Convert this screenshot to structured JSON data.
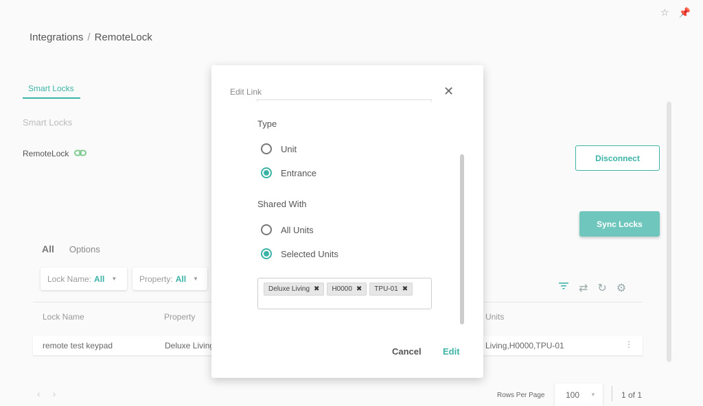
{
  "header": {
    "breadcrumb": [
      "Integrations",
      "RemoteLock"
    ],
    "breadcrumb_sep": "/",
    "icons": [
      "star-icon",
      "pin-icon"
    ]
  },
  "tabs": {
    "active": "Smart Locks"
  },
  "section": {
    "title": "Smart Locks"
  },
  "integration": {
    "name": "RemoteLock",
    "status_icon": "link-icon"
  },
  "buttons": {
    "disconnect": "Disconnect",
    "sync": "Sync Locks"
  },
  "subtabs": {
    "all": "All",
    "options": "Options"
  },
  "filters": [
    {
      "label": "Lock Name:",
      "value": "All"
    },
    {
      "label": "Property:",
      "value": "All"
    }
  ],
  "toolbar_icons": [
    "filter-icon",
    "sync-icon",
    "refresh-icon",
    "settings-icon"
  ],
  "table": {
    "columns": [
      "Lock Name",
      "Property",
      "Units"
    ],
    "rows": [
      {
        "lock_name": "remote test keypad",
        "property": "Deluxe Living",
        "units": "e Living,H0000,TPU-01"
      }
    ]
  },
  "pagination": {
    "rows_label": "Rows Per Page",
    "rows_value": "100",
    "page_text": "1 of 1"
  },
  "modal": {
    "title": "Edit Link",
    "type_label": "Type",
    "type_options": [
      {
        "label": "Unit",
        "checked": false
      },
      {
        "label": "Entrance",
        "checked": true
      }
    ],
    "shared_label": "Shared With",
    "shared_options": [
      {
        "label": "All Units",
        "checked": false
      },
      {
        "label": "Selected Units",
        "checked": true
      }
    ],
    "chips": [
      "Deluxe Living",
      "H0000",
      "TPU-01"
    ],
    "cancel": "Cancel",
    "edit": "Edit"
  },
  "colors": {
    "accent": "#3bb3a6",
    "sync_bg": "#6fc6bd"
  }
}
